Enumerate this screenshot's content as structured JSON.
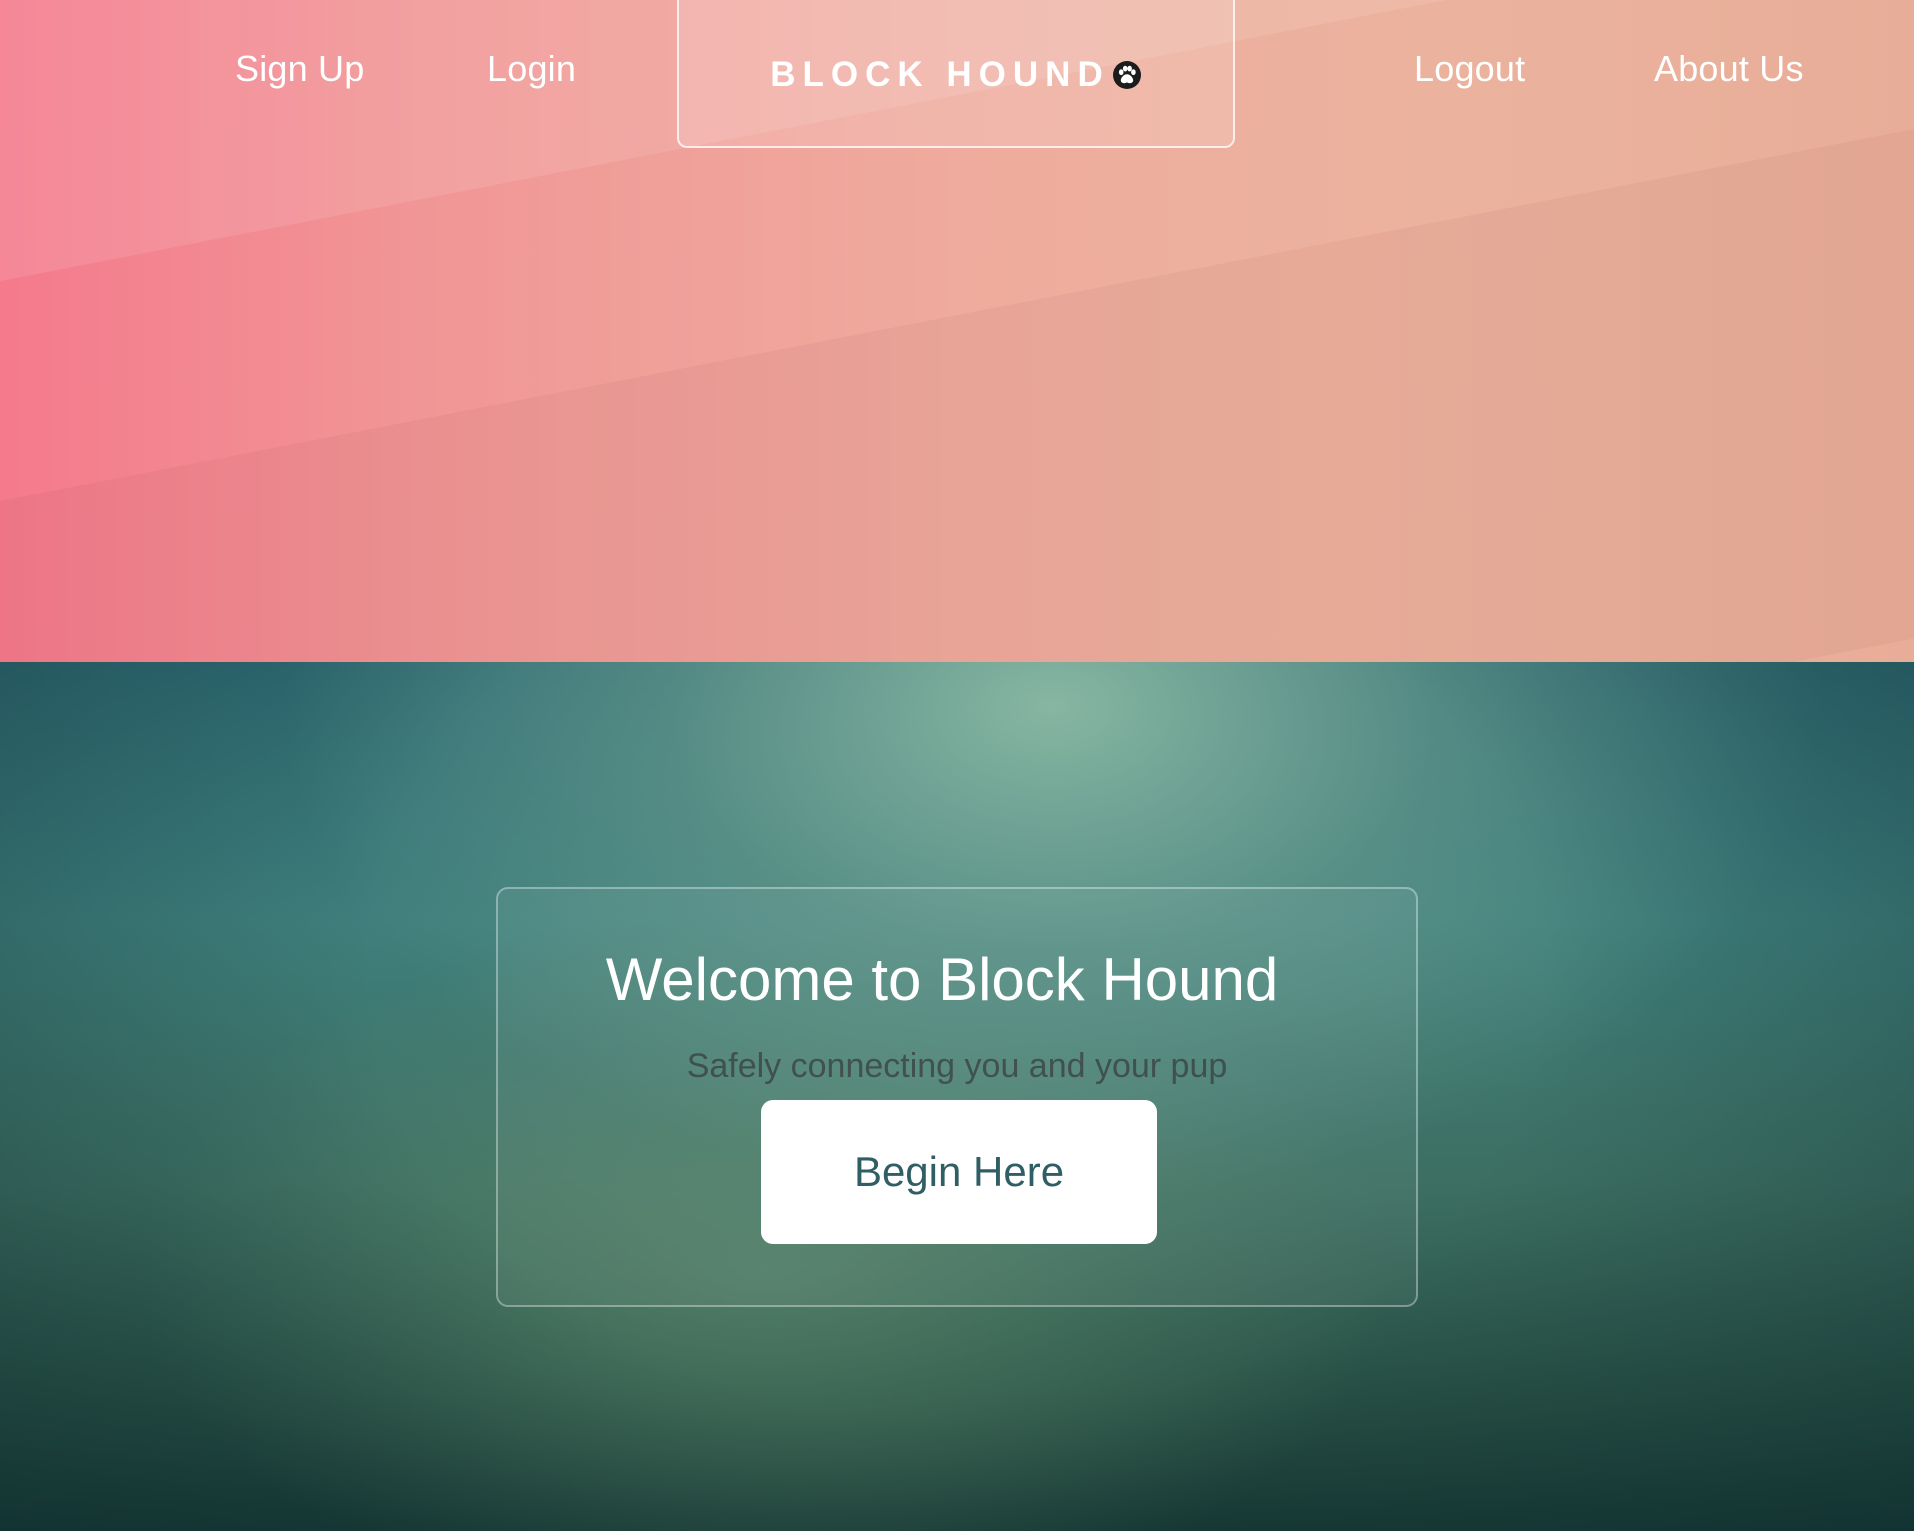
{
  "nav": {
    "sign_up": "Sign Up",
    "login": "Login",
    "logout": "Logout",
    "about_us": "About Us"
  },
  "brand": {
    "name": "BLOCK HOUND",
    "icon": "paw-icon"
  },
  "hero": {
    "title": "Welcome to Block Hound",
    "subtitle": "Safely connecting you and your pup",
    "cta_label": "Begin Here"
  },
  "colors": {
    "header_gradient_start": "#f47a8c",
    "header_gradient_end": "#e8ad98",
    "hero_teal": "#3f7f7c",
    "hero_dark": "#183a35",
    "cta_text": "#2f5e65",
    "cta_background": "#ffffff"
  }
}
